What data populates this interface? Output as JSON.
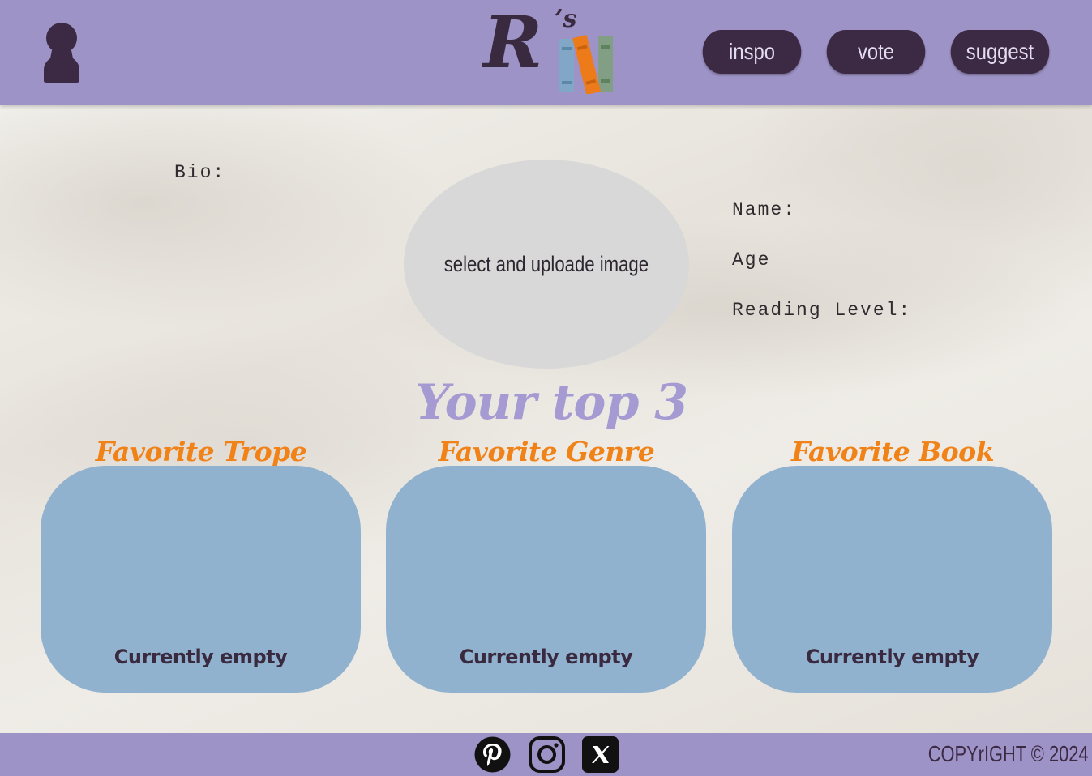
{
  "header": {
    "logo": {
      "main": "R",
      "suffix": "’s"
    },
    "nav": [
      {
        "label": "inspo"
      },
      {
        "label": "vote"
      },
      {
        "label": "suggest"
      }
    ]
  },
  "profile": {
    "bio_label": "Bio:",
    "name_label": "Name:",
    "age_label": "Age",
    "reading_level_label": "Reading Level:",
    "upload_text": "select and uploade image"
  },
  "top3": {
    "title": "Your top 3",
    "cards": [
      {
        "heading": "Favorite Trope",
        "status": "Currently empty"
      },
      {
        "heading": "Favorite Genre",
        "status": "Currently empty"
      },
      {
        "heading": "Favorite Book",
        "status": "Currently empty"
      }
    ]
  },
  "footer": {
    "social": [
      "pinterest-icon",
      "instagram-icon",
      "x-icon"
    ],
    "copyright": "COPYrIGHT © 2024"
  },
  "colors": {
    "header_bg": "#9d93c6",
    "dark": "#3c2a45",
    "accent_orange": "#f08218",
    "title_purple": "#a59bd2",
    "card_blue": "#91b2cf",
    "upload_gray": "#d8d8d8"
  }
}
